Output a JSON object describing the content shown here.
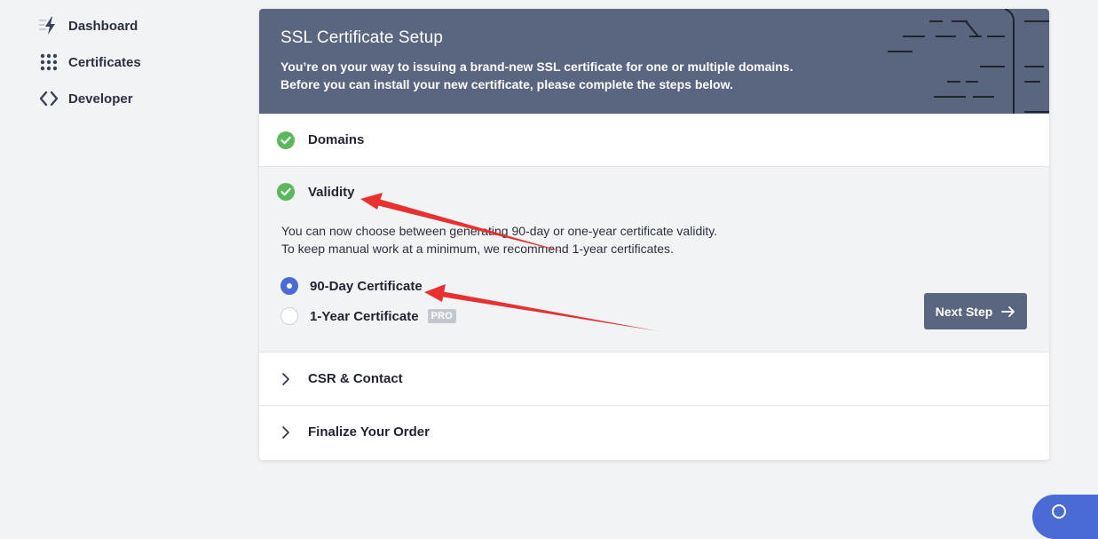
{
  "sidebar": {
    "items": [
      {
        "label": "Dashboard",
        "icon": "lightning-icon"
      },
      {
        "label": "Certificates",
        "icon": "grid-icon"
      },
      {
        "label": "Developer",
        "icon": "code-brackets-icon"
      }
    ]
  },
  "banner": {
    "title": "SSL Certificate Setup",
    "line1": "You’re on your way to issuing a brand-new SSL certificate for one or multiple domains.",
    "line2": "Before you can install your new certificate, please complete the steps below."
  },
  "steps": {
    "domains": {
      "title": "Domains",
      "status": "complete"
    },
    "validity": {
      "title": "Validity",
      "status": "complete",
      "desc1": "You can now choose between generating 90-day or one-year certificate validity.",
      "desc2": "To keep manual work at a minimum, we recommend 1-year certificates.",
      "options": [
        {
          "label": "90-Day Certificate",
          "selected": true
        },
        {
          "label": "1-Year Certificate",
          "selected": false,
          "badge": "PRO"
        }
      ],
      "next_label": "Next Step"
    },
    "csr": {
      "title": "CSR & Contact",
      "status": "collapsed"
    },
    "finalize": {
      "title": "Finalize Your Order",
      "status": "collapsed"
    }
  },
  "colors": {
    "banner_bg": "#5a6580",
    "check_green": "#5cb85c",
    "radio_blue": "#4a6ad6",
    "annotation_red": "#e8302f"
  }
}
